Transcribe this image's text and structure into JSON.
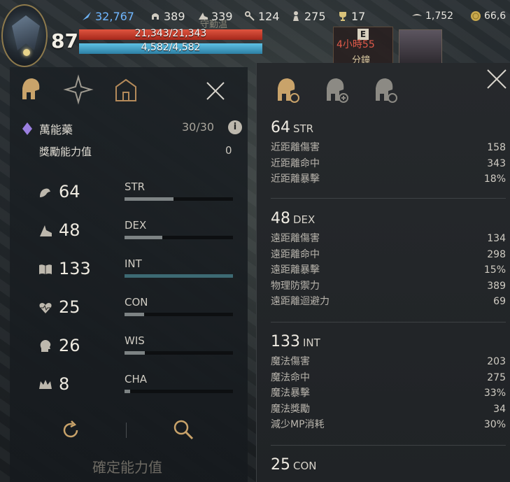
{
  "topbar": {
    "level": "87",
    "currencies": [
      {
        "name": "diamond",
        "value": "32,767",
        "icon": "feather-icon"
      },
      {
        "name": "helmet",
        "value": "389",
        "icon": "helmet-icon"
      },
      {
        "name": "boot",
        "value": "339",
        "icon": "boot-icon"
      },
      {
        "name": "key",
        "value": "124",
        "icon": "key-icon"
      },
      {
        "name": "figure",
        "value": "275",
        "icon": "figure-icon"
      },
      {
        "name": "trophy",
        "value": "17",
        "icon": "trophy-icon"
      },
      {
        "name": "wing",
        "value": "1,752",
        "icon": "wing-icon"
      },
      {
        "name": "gold",
        "value": "66,6",
        "icon": "gold-coin-icon"
      }
    ],
    "hp_text": "21,343/21,343",
    "mp_text": "4,582/4,582",
    "bg_text": "守勤温",
    "timer_line1": "4小時55",
    "timer_line2": "分鐘",
    "timer_badge": "E"
  },
  "left": {
    "elixir_label": "萬能藥",
    "elixir_value": "30/30",
    "bonus_label": "獎勵能力值",
    "bonus_value": "0",
    "stats": [
      {
        "name": "STR",
        "value": "64",
        "icon": "arm-icon",
        "fill": 0.45
      },
      {
        "name": "DEX",
        "value": "48",
        "icon": "boot-icon",
        "fill": 0.35
      },
      {
        "name": "INT",
        "value": "133",
        "icon": "book-icon",
        "fill": 1.0
      },
      {
        "name": "CON",
        "value": "25",
        "icon": "heart-icon",
        "fill": 0.18
      },
      {
        "name": "WIS",
        "value": "26",
        "icon": "head-icon",
        "fill": 0.19
      },
      {
        "name": "CHA",
        "value": "8",
        "icon": "crown-icon",
        "fill": 0.05
      }
    ],
    "confirm_label": "確定能力值"
  },
  "right": {
    "sections": [
      {
        "value": "64",
        "unit": "STR",
        "rows": [
          [
            "近距離傷害",
            "158"
          ],
          [
            "近距離命中",
            "343"
          ],
          [
            "近距離暴擊",
            "18%"
          ]
        ]
      },
      {
        "value": "48",
        "unit": "DEX",
        "rows": [
          [
            "遠距離傷害",
            "134"
          ],
          [
            "遠距離命中",
            "298"
          ],
          [
            "遠距離暴擊",
            "15%"
          ],
          [
            "物理防禦力",
            "389"
          ],
          [
            "遠距離迴避力",
            "69"
          ]
        ]
      },
      {
        "value": "133",
        "unit": "INT",
        "rows": [
          [
            "魔法傷害",
            "203"
          ],
          [
            "魔法命中",
            "275"
          ],
          [
            "魔法暴擊",
            "33%"
          ],
          [
            "魔法獎勵",
            "34"
          ],
          [
            "減少MP消耗",
            "30%"
          ]
        ]
      },
      {
        "value": "25",
        "unit": "CON",
        "rows": []
      }
    ]
  },
  "colors": {
    "hp": "#c43a2a",
    "mp": "#3d9cc4",
    "diamond": "#6fb6ff",
    "gold": "#c9a94e"
  }
}
